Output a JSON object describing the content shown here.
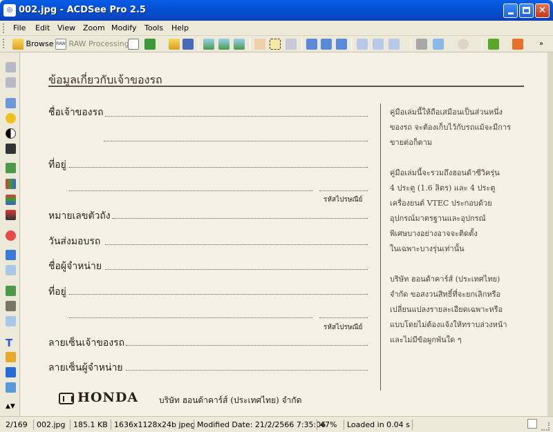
{
  "window": {
    "title": "002.jpg - ACDSee Pro 2.5",
    "app_icon": "acdsee-app-icon"
  },
  "menubar": {
    "items": [
      "File",
      "Edit",
      "View",
      "Zoom",
      "Modify",
      "Tools",
      "Help"
    ]
  },
  "toolbar": {
    "browse_label": "Browse",
    "raw_label": "RAW Processing"
  },
  "document": {
    "heading": "ข้อมูลเกี่ยวกับเจ้าของรถ",
    "fields": {
      "owner_name": "ชื่อเจ้าของรถ",
      "address1": "ที่อยู่",
      "postal1": "รหัสไปรษณีย์",
      "plate": "หมายเลขตัวถัง",
      "delivery_date": "วันส่งมอบรถ",
      "dealer_name": "ชื่อผู้จำหน่าย",
      "address2": "ที่อยู่",
      "postal2": "รหัสไปรษณีย์",
      "owner_sig": "ลายเซ็นเจ้าของรถ",
      "dealer_sig": "ลายเซ็นผู้จำหน่าย"
    },
    "side_notes": [
      [
        "คู่มือเล่มนี้ให้ถือเสมือนเป็นส่วนหนึ่ง",
        "ของรถ จะต้องเก็บไว้กับรถแม้จะมีการ",
        "ขายต่อก็ตาม"
      ],
      [
        "คู่มือเล่มนี้จะรวมถึงฮอนด้าซีวิครุ่น",
        "4 ประตู (1.6 ลิตร) และ 4 ประตู",
        "เครื่องยนต์ VTEC ประกอบด้วย",
        "อุปกรณ์มาตรฐานและอุปกรณ์",
        "พิเศษบางอย่างอาจจะติดตั้ง",
        "ในเฉพาะบางรุ่นเท่านั้น"
      ],
      [
        "บริษัท ฮอนด้าคาร์ส์ (ประเทศไทย)",
        "จำกัด ขอสงวนสิทธิ์ที่จะยกเลิกหรือ",
        "เปลี่ยนแปลงรายละเอียดเฉพาะหรือ",
        "แบบโดยไม่ต้องแจ้งให้ทราบล่วงหน้า",
        "และไม่มีข้อผูกพันใด ๆ"
      ]
    ],
    "brand": "HONDA",
    "company": "บริษัท ฮอนด้าคาร์ส์ (ประเทศไทย) จำกัด"
  },
  "statusbar": {
    "index": "2/169",
    "filename": "002.jpg",
    "filesize": "185.1 KB",
    "dimensions": "1636x1128x24b jpeg",
    "modified": "Modified Date: 21/2/2566 7:35:06",
    "zoom": "47%",
    "loaded": "Loaded in 0.04 s"
  }
}
